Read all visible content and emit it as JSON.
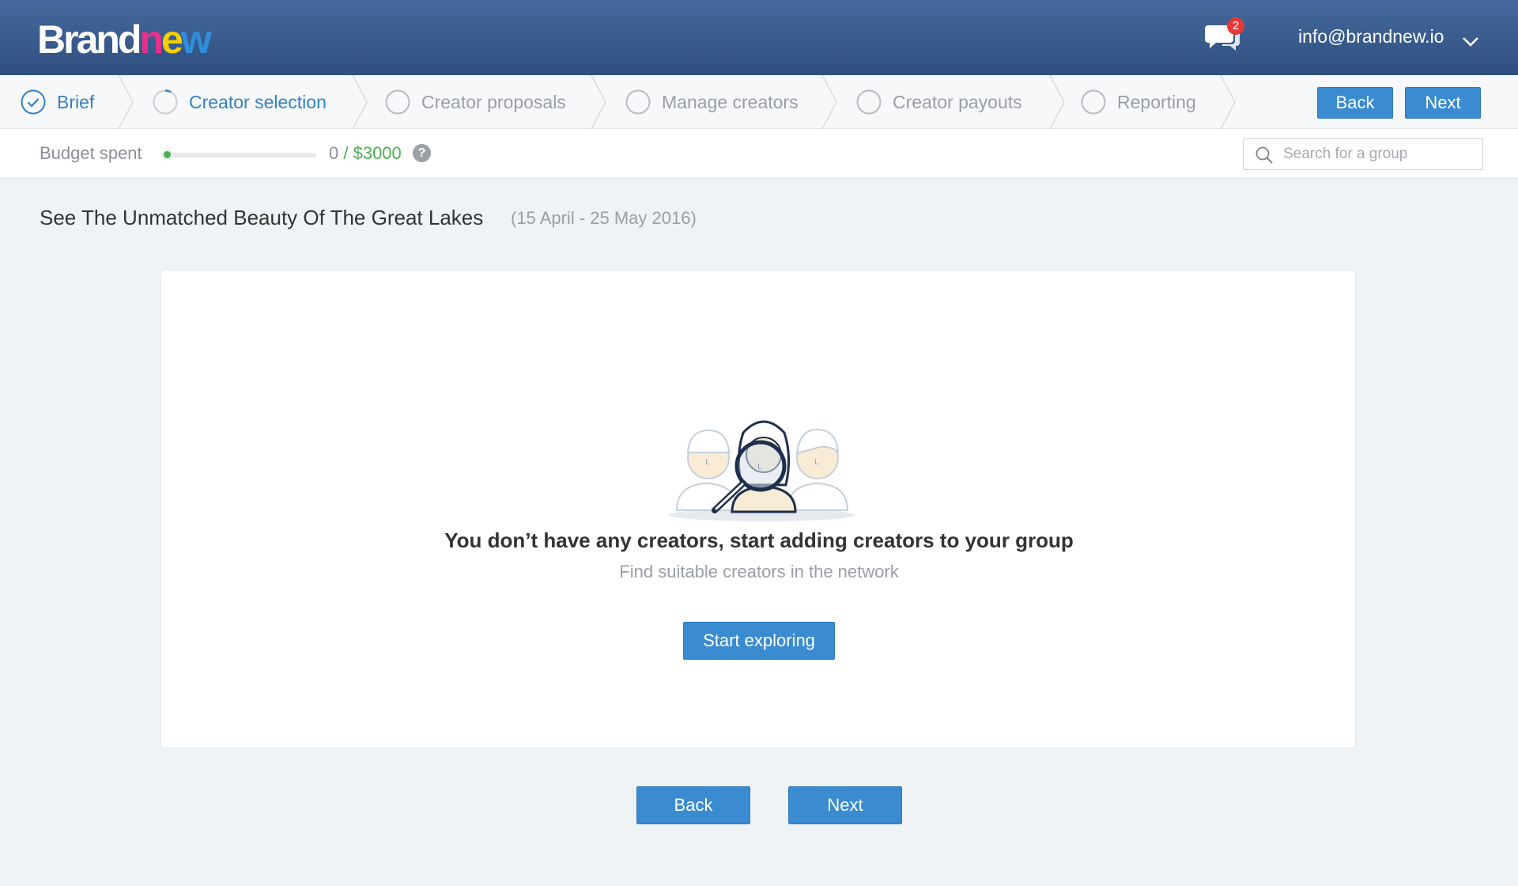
{
  "header": {
    "logo": {
      "part1": "Brand",
      "letters": [
        "n",
        "e",
        "w"
      ],
      "letter_colors": [
        "#e8308a",
        "#f5d000",
        "#2f8fdc"
      ]
    },
    "chat_badge": "2",
    "user_email": "info@brandnew.io"
  },
  "steps": [
    {
      "label": "Brief",
      "state": "done"
    },
    {
      "label": "Creator selection",
      "state": "active"
    },
    {
      "label": "Creator proposals",
      "state": "pending"
    },
    {
      "label": "Manage creators",
      "state": "pending"
    },
    {
      "label": "Creator payouts",
      "state": "pending"
    },
    {
      "label": "Reporting",
      "state": "pending"
    }
  ],
  "nav": {
    "back_label": "Back",
    "next_label": "Next"
  },
  "budget": {
    "label": "Budget spent",
    "spent": "0",
    "separator": " / ",
    "total": "$3000",
    "progress_fraction": 0.0,
    "help": "?"
  },
  "search": {
    "placeholder": "Search for a group",
    "value": ""
  },
  "campaign": {
    "title": "See The Unmatched Beauty Of The Great Lakes",
    "dates": "(15 April - 25 May 2016)"
  },
  "empty_state": {
    "title": "You don’t have any creators, start adding creators to your group",
    "subtitle": "Find suitable creators in the network",
    "button": "Start exploring"
  },
  "footer": {
    "back_label": "Back",
    "next_label": "Next"
  },
  "colors": {
    "accent": "#3a8bd0",
    "header": "#3a5d8f",
    "budget": "#4caf50",
    "badge": "#e53935"
  }
}
